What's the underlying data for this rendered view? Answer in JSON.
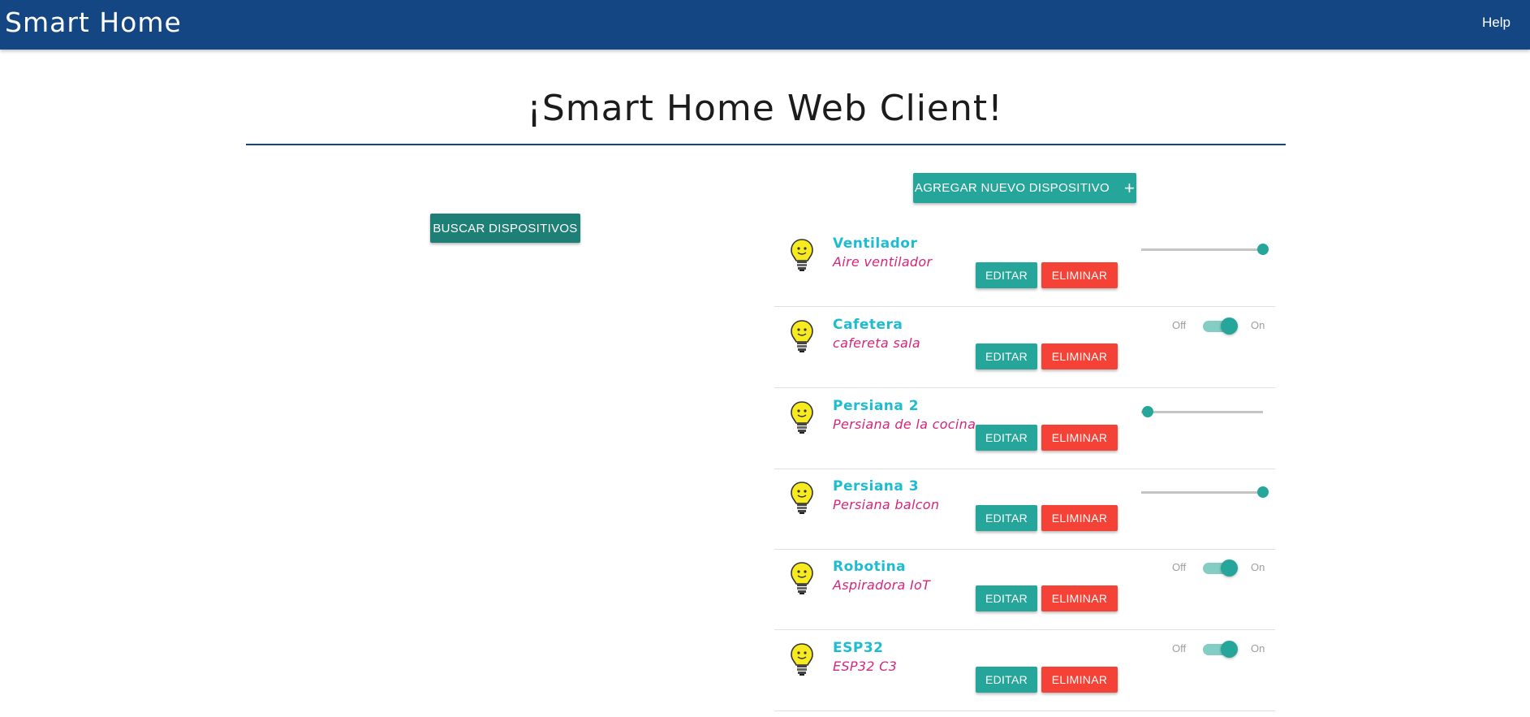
{
  "navbar": {
    "brand": "Smart Home",
    "help": "Help"
  },
  "main": {
    "title": "¡Smart Home Web Client!",
    "add_button": "AGREGAR NUEVO DISPOSITIVO",
    "add_icon": "+",
    "search_button": "BUSCAR DISPOSITIVOS"
  },
  "labels": {
    "edit": "EDITAR",
    "delete": "ELIMINAR",
    "off": "Off",
    "on": "On"
  },
  "devices": [
    {
      "name": "Ventilador",
      "description": "Aire ventilador",
      "control": "slider",
      "value": 1.0
    },
    {
      "name": "Cafetera",
      "description": "cafereta sala",
      "control": "switch",
      "state": "on"
    },
    {
      "name": "Persiana 2",
      "description": "Persiana de la cocina",
      "control": "slider",
      "value": 0.05
    },
    {
      "name": "Persiana 3",
      "description": "Persiana balcon",
      "control": "slider",
      "value": 1.0
    },
    {
      "name": "Robotina",
      "description": "Aspiradora IoT",
      "control": "switch",
      "state": "on"
    },
    {
      "name": "ESP32",
      "description": "ESP32 C3",
      "control": "switch",
      "state": "on"
    }
  ],
  "colors": {
    "navbar": "#144683",
    "accent": "#26a69a",
    "danger": "#f44336",
    "device_name": "#1ebcd0",
    "device_desc": "#d6257a"
  },
  "icons": {
    "device": "lightbulb-icon"
  }
}
